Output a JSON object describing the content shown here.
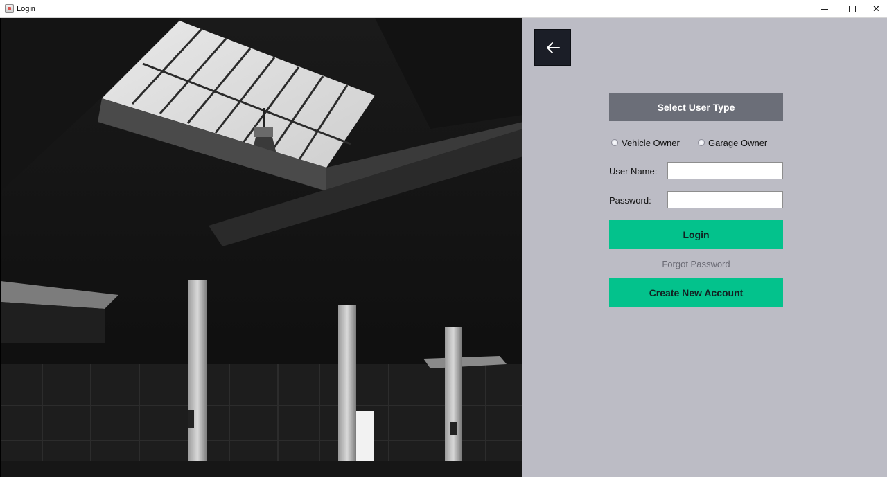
{
  "window": {
    "title": "Login",
    "minimize_icon": "minimize-icon",
    "maximize_icon": "maximize-icon",
    "close_glyph": "✕"
  },
  "photo": {
    "subject": "warehouse-interior-image"
  },
  "form": {
    "back_icon": "arrow-left-icon",
    "select_user_type_label": "Select User Type",
    "user_types": [
      {
        "label": "Vehicle Owner",
        "selected": false
      },
      {
        "label": "Garage Owner",
        "selected": false
      }
    ],
    "username_label": "User Name:",
    "username_value": "",
    "password_label": "Password:",
    "password_value": "",
    "login_label": "Login",
    "forgot_password_label": "Forgot Password",
    "create_account_label": "Create New Account"
  },
  "colors": {
    "panel_bg": "#bcbcc5",
    "header_btn": "#6b6e78",
    "accent_green": "#03c28c",
    "back_btn": "#1b1e27"
  }
}
